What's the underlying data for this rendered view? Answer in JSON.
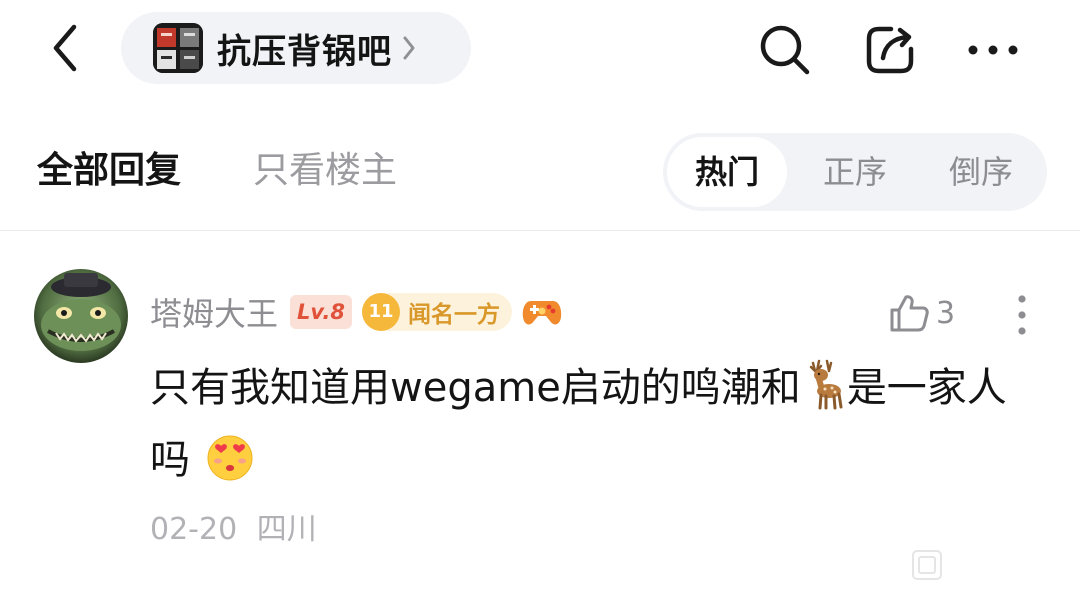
{
  "header": {
    "forum_name": "抗压背锅吧",
    "forum_logo_text": "抗压背锅",
    "icons": [
      "back-icon",
      "chevron-right-icon",
      "search-icon",
      "share-icon",
      "more-icon"
    ]
  },
  "reply_filter": {
    "tabs": [
      {
        "label": "全部回复",
        "active": true
      },
      {
        "label": "只看楼主",
        "active": false
      }
    ]
  },
  "sort": {
    "options": [
      {
        "label": "热门",
        "active": true
      },
      {
        "label": "正序",
        "active": false
      },
      {
        "label": "倒序",
        "active": false
      }
    ]
  },
  "reply": {
    "username": "塔姆大王",
    "level": "Lv.8",
    "title_badge": {
      "number": "11",
      "label": "闻名一方"
    },
    "like_count": "3",
    "text_part1": "只有我知道用wegame启动的鸣潮和",
    "text_part2": "是一家人吗",
    "emojis": [
      "deer-emoji",
      "heart-eyes-kiss-emoji"
    ],
    "date": "02-20",
    "location": "四川"
  },
  "colors": {
    "level_badge_bg": "#fbe0d7",
    "level_badge_text": "#e0523a",
    "title_badge_bg": "#fdf3dc",
    "title_badge_text": "#d9982a",
    "pill_bg": "#f2f3f7"
  }
}
